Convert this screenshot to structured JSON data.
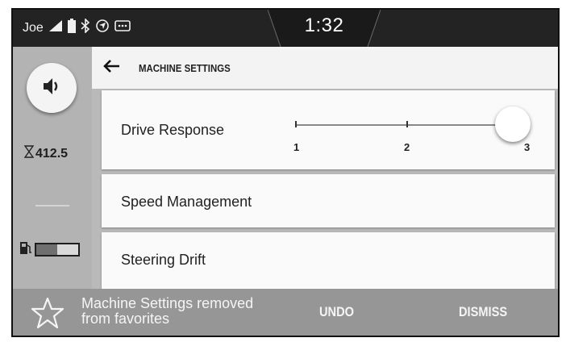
{
  "status_bar": {
    "user": "Joe",
    "icons": [
      "signal-icon",
      "battery-icon",
      "bluetooth-icon",
      "gps-icon",
      "message-icon"
    ],
    "time": "1:32"
  },
  "side_panel": {
    "volume_icon": "speaker-icon",
    "hours_icon": "hourglass-icon",
    "hours": "412.5",
    "fuel_icon": "fuel-pump-icon",
    "fuel_level": 0.5
  },
  "header": {
    "back_icon": "arrow-left-icon",
    "title": "MACHINE SETTINGS"
  },
  "settings": {
    "drive_response": {
      "label": "Drive Response",
      "slider": {
        "min": 1,
        "max": 3,
        "value": 3,
        "ticks": [
          "1",
          "2",
          "3"
        ]
      }
    },
    "speed_management": {
      "label": "Speed Management"
    },
    "steering_drift": {
      "label": "Steering Drift"
    }
  },
  "snackbar": {
    "icon": "star-icon",
    "message_line1": "Machine Settings removed",
    "message_line2": "from favorites",
    "undo_label": "UNDO",
    "dismiss_label": "DISMISS"
  },
  "colors": {
    "status_bar": "#232323",
    "side_panel": "#b3b3b3",
    "snackbar": "#969696",
    "card": "#fafafa"
  }
}
